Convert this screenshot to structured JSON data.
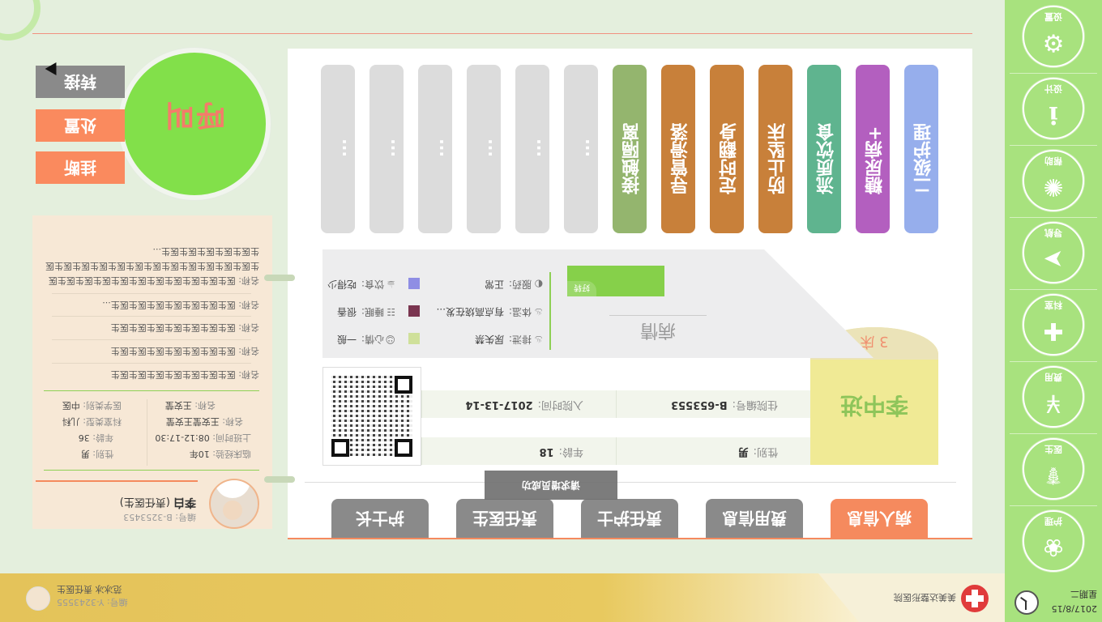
{
  "footer": {
    "hospital": "美美达整形医院",
    "user_name": "范冰冰   责任医生",
    "user_code": "编号: Y-3243555"
  },
  "nav": {
    "date": "2017/8/15",
    "weekday": "星期二",
    "items": [
      {
        "label": "护理",
        "icon": "paw-icon"
      },
      {
        "label": "医生",
        "icon": "doctor-icon"
      },
      {
        "label": "费用",
        "icon": "yen-icon"
      },
      {
        "label": "科室",
        "icon": "cross-icon"
      },
      {
        "label": "导航",
        "icon": "navigation-icon"
      },
      {
        "label": "帮助",
        "icon": "bulb-icon"
      },
      {
        "label": "设计",
        "icon": "info-icon"
      },
      {
        "label": "设置",
        "icon": "gear-icon"
      }
    ]
  },
  "tabs": [
    "病人信息",
    "费用信息",
    "责任护士",
    "责任医生",
    "护士长"
  ],
  "patient": {
    "name": "李中进",
    "bed": "3 床",
    "gender_label": "性别:",
    "gender": "男",
    "age_label": "年龄:",
    "age": "18",
    "id_label": "住院编号:",
    "id": "B-653553",
    "admit_label": "入院时间:",
    "admit": "2017-13-14"
  },
  "condition": {
    "title": "病情",
    "status": "好转",
    "toast": "请求增员成功",
    "rows": [
      {
        "label": "排泄:",
        "value": "尿失禁",
        "color": "#cfe09a"
      },
      {
        "label": "心情:",
        "value": "一般",
        "color": "#86d56c"
      },
      {
        "label": "体温:",
        "value": "有点高烧在发...",
        "color": "#7a3550"
      },
      {
        "label": "睡眠:",
        "value": "很香",
        "color": "#8ee0cc"
      },
      {
        "label": "服药:",
        "value": "正常",
        "color": "#8f8ee4"
      },
      {
        "label": "饮食:",
        "value": "吃得少",
        "color": "#bb88e0"
      }
    ]
  },
  "orders": [
    {
      "label": "二级护理",
      "color": "#96aeec"
    },
    {
      "label": "糖尿病+",
      "color": "#b35fbf"
    },
    {
      "label": "流质饮食",
      "color": "#5fb48f"
    },
    {
      "label": "防止坠床",
      "color": "#c8803a"
    },
    {
      "label": "定时翻身",
      "color": "#c8803a"
    },
    {
      "label": "导管滑落",
      "color": "#c8803a"
    },
    {
      "label": "接触隔离",
      "color": "#94b56e"
    },
    {
      "label": "...",
      "color": "#dcdcdc"
    },
    {
      "label": "...",
      "color": "#dcdcdc"
    },
    {
      "label": "...",
      "color": "#dcdcdc"
    },
    {
      "label": "...",
      "color": "#dcdcdc"
    },
    {
      "label": "...",
      "color": "#dcdcdc"
    },
    {
      "label": "...",
      "color": "#dcdcdc"
    }
  ],
  "doctor": {
    "name": "李白",
    "role": "(责任医生)",
    "code_label": "编号:",
    "code": "B-3253453",
    "gender_label": "性别:",
    "gender": "男",
    "exp_label": "临床经验:",
    "exp": "10年",
    "age_label": "年龄:",
    "age": "36",
    "shift_label": "上班时间:",
    "shift": "08:12-17:30",
    "dept_label": "科室类型:",
    "dept": "儿科",
    "name2_label": "名称:",
    "name2": "王安莹王安莹",
    "cat_label": "医学类别:",
    "cat": "中医",
    "name3_label": "名称:",
    "name3": "王安莹",
    "notes": [
      {
        "label": "名称:",
        "value": "医生医生医生医生医生医生医生"
      },
      {
        "label": "名称:",
        "value": "医生医生医生医生医生医生医生"
      },
      {
        "label": "名称:",
        "value": "医生医生医生医生医生医生医生"
      },
      {
        "label": "名称:",
        "value": "医生医生医生医生医生医生医生..."
      },
      {
        "label": "名称:",
        "value": "医生医生医生医生医生医生医生医生医生医生医生医生医生医生医生医生医生医生医生医生医生医生医生医生医生医生医生医生..."
      }
    ]
  },
  "actions": {
    "call": "呼叫",
    "hangup": "挂断",
    "handle": "处置",
    "transfer": "转接"
  }
}
